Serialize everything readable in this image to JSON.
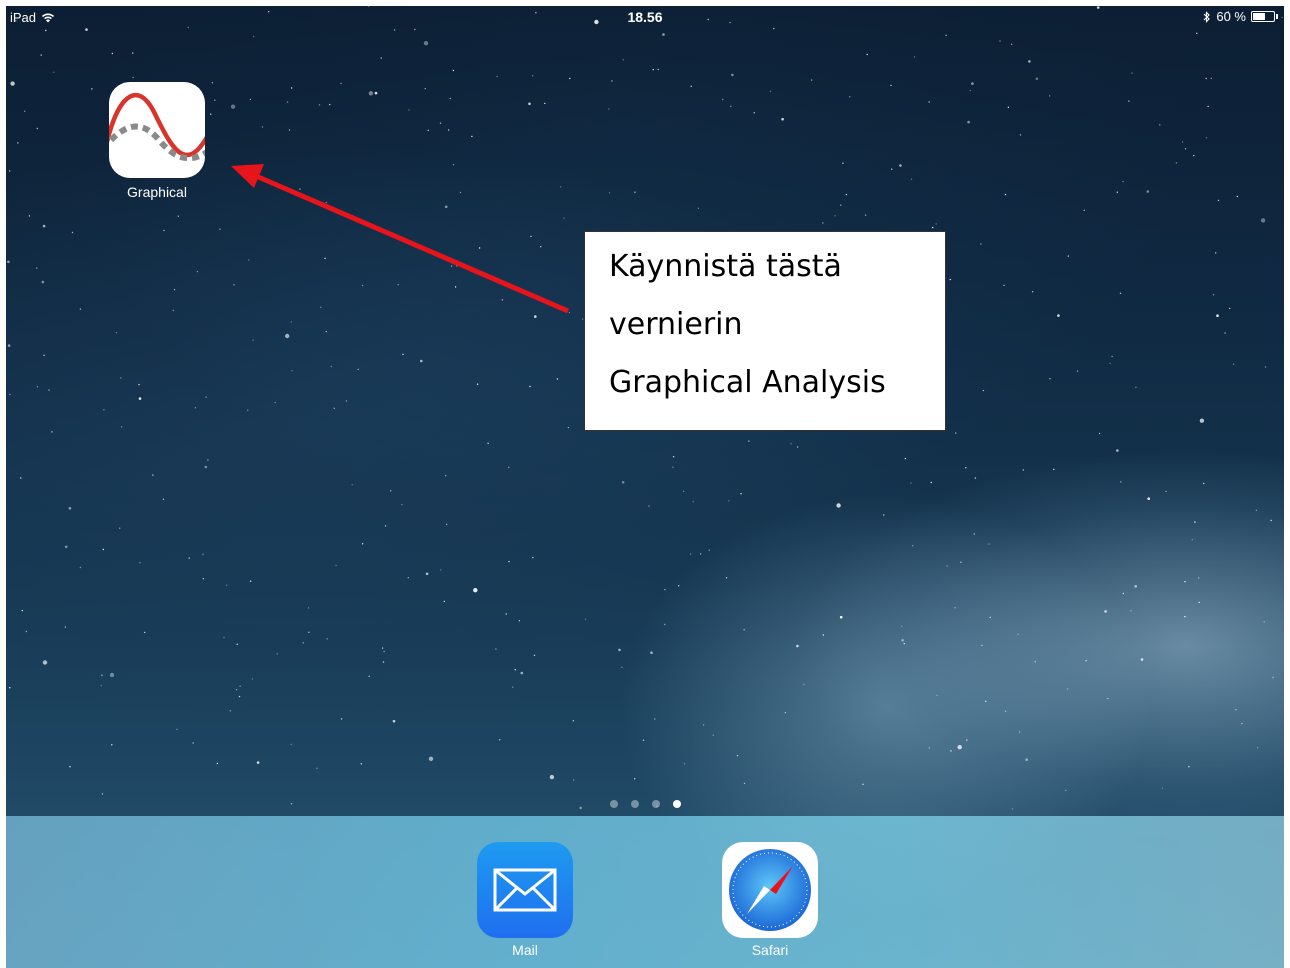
{
  "status_bar": {
    "device": "iPad",
    "time": "18.56",
    "battery": "60 %",
    "battery_level": 0.6
  },
  "home_screen": {
    "apps": [
      {
        "label": "Graphical",
        "icon": "graphical-analysis-icon"
      }
    ],
    "page_indicator": {
      "pages": 4,
      "current": 4
    }
  },
  "annotation": {
    "lines": [
      "Käynnistä tästä",
      "vernierin",
      "Graphical Analysis"
    ],
    "arrow_color": "#e8141b"
  },
  "dock": {
    "apps": [
      {
        "label": "Mail",
        "icon": "mail-icon"
      },
      {
        "label": "Safari",
        "icon": "safari-icon"
      }
    ]
  }
}
